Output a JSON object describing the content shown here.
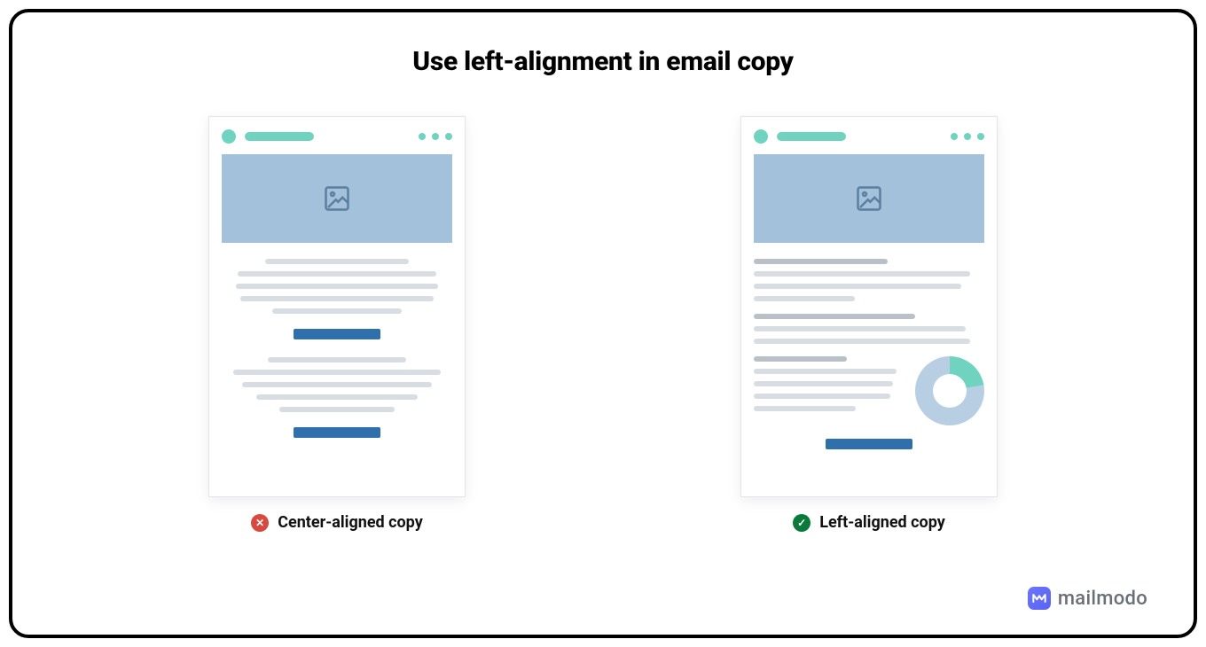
{
  "title": "Use left-alignment in email copy",
  "variants": {
    "bad": {
      "caption": "Center-aligned copy",
      "status": "bad"
    },
    "good": {
      "caption": "Left-aligned copy",
      "status": "good"
    }
  },
  "brand": {
    "name": "mailmodo"
  },
  "colors": {
    "accent_teal": "#6fd3c0",
    "hero_blue": "#a3c1da",
    "button_blue": "#2f6fab",
    "line_gray": "#d7dde2",
    "line_dark": "#b9c0c7",
    "bad_red": "#d84a3f",
    "good_green": "#0a7a3b"
  },
  "icons": {
    "error": "✕",
    "check": "✓"
  }
}
